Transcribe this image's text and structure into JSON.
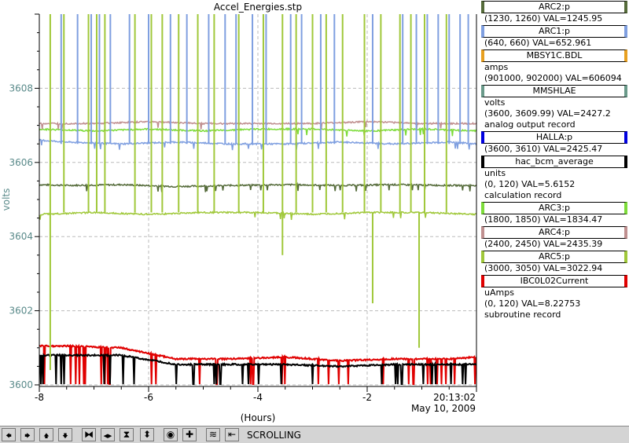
{
  "window_title": "Accel_Energies.stp",
  "chart_data": {
    "type": "line",
    "title": "Accel_Energies.stp",
    "xlabel": "(Hours)",
    "ylabel": "volts",
    "xlim": [
      -8,
      0
    ],
    "ylim": [
      3600,
      3610
    ],
    "x_ticks": [
      "-8",
      "-6",
      "-4",
      "-2"
    ],
    "y_ticks": [
      "3600",
      "3602",
      "3604",
      "3606",
      "3608"
    ],
    "time_label": "20:13:02",
    "date_label": "May 10, 2009",
    "grid": true,
    "legend_placement": "right",
    "series": [
      {
        "name": "ARC2:p",
        "color": "#556b3a",
        "range": "(1230, 1260)",
        "value": "VAL=1245.95",
        "baseline": 3605.38,
        "x": [
          -8,
          -7.5,
          -6.5,
          -5.5,
          -4.5,
          -3.5,
          -2.5,
          -1.5,
          -0.5,
          0
        ],
        "y": [
          3605.4,
          3605.38,
          3605.4,
          3605.35,
          3605.38,
          3605.4,
          3605.38,
          3605.4,
          3605.38,
          3605.38
        ]
      },
      {
        "name": "ARC1:p",
        "color": "#7f9fe0",
        "range": "(640, 660)",
        "value": "VAL=652.961",
        "baseline": 3606.5,
        "x": [
          -8,
          -7.5,
          -6.5,
          -5.5,
          -4.5,
          -3.5,
          -2.5,
          -1.5,
          -0.5,
          0
        ],
        "y": [
          3606.6,
          3606.55,
          3606.5,
          3606.55,
          3606.5,
          3606.5,
          3606.55,
          3606.5,
          3606.55,
          3606.5
        ]
      },
      {
        "name": "ARC3:p",
        "color": "#7ddc3a",
        "range": "(1800, 1850)",
        "value": "VAL=1834.47",
        "baseline": 3606.9,
        "x": [
          -8,
          -7,
          -6,
          -5,
          -4,
          -3,
          -2,
          -1,
          0
        ],
        "y": [
          3606.9,
          3606.85,
          3606.9,
          3606.85,
          3606.9,
          3606.9,
          3606.85,
          3606.9,
          3606.85
        ]
      },
      {
        "name": "ARC4:p",
        "color": "#c09090",
        "range": "(2400, 2450)",
        "value": "VAL=2435.39",
        "baseline": 3607.05,
        "x": [
          -8,
          -7,
          -6,
          -5,
          -4,
          -3,
          -2,
          -1,
          0
        ],
        "y": [
          3607.05,
          3607.05,
          3607.1,
          3607.05,
          3607.05,
          3607.05,
          3607.1,
          3607.05,
          3607.05
        ]
      },
      {
        "name": "ARC5:p",
        "color": "#a0c83a",
        "range": "(3000, 3050)",
        "value": "VAL=3022.94",
        "baseline": 3604.65,
        "x": [
          -8,
          -7,
          -6,
          -5,
          -4,
          -3,
          -2,
          -1,
          0
        ],
        "y": [
          3604.6,
          3604.65,
          3604.6,
          3604.65,
          3604.65,
          3604.6,
          3604.65,
          3604.65,
          3604.6
        ]
      },
      {
        "name": "IBC0L02Current",
        "color": "#e00000",
        "range": "(0, 120)",
        "value": "VAL=8.22753",
        "baseline": 3601.05,
        "x": [
          -8,
          -7.5,
          -6.5,
          -5.5,
          -4.5,
          -3.5,
          -2.5,
          -1.5,
          -0.5,
          0
        ],
        "y": [
          3601.05,
          3601.05,
          3601.0,
          3600.7,
          3600.7,
          3600.75,
          3600.65,
          3600.7,
          3600.7,
          3600.75
        ]
      },
      {
        "name": "hac_bcm_average",
        "color": "#000000",
        "range": "(0, 120)",
        "value": "VAL=5.6152",
        "baseline": 3600.8,
        "x": [
          -8,
          -7.5,
          -6.5,
          -5.5,
          -4.5,
          -3.5,
          -2.5,
          -1.5,
          -0.5,
          0
        ],
        "y": [
          3600.8,
          3600.8,
          3600.8,
          3600.55,
          3600.55,
          3600.55,
          3600.5,
          3600.55,
          3600.55,
          3600.55
        ]
      }
    ],
    "spikes": [
      {
        "series": "ARC1:p",
        "x": [
          -7.6,
          -7.3,
          -7.05,
          -6.9,
          -6.7,
          -6.35,
          -6.0,
          -5.6,
          -5.3,
          -4.9,
          -4.6,
          -4.4,
          -4.1,
          -3.85,
          -3.4,
          -3.2,
          -2.85,
          -2.6,
          -1.9,
          -1.35,
          -1.1,
          -0.9,
          -0.7,
          -0.5,
          -0.3,
          -0.15
        ]
      },
      {
        "series": "ARC5:p",
        "x": [
          -7.8,
          -7.55,
          -7.1,
          -6.95,
          -6.8,
          -6.25,
          -5.95,
          -5.75,
          -5.45,
          -5.1,
          -4.8,
          -4.35,
          -3.9,
          -3.55,
          -3.3,
          -3.0,
          -2.75,
          -2.45,
          -2.05,
          -1.75,
          -1.4,
          -1.2,
          -0.95,
          -0.55
        ]
      }
    ]
  },
  "legend": [
    {
      "name": "ARC2:p",
      "color": "#556b3a",
      "lines": [
        "(1230, 1260) VAL=1245.95"
      ]
    },
    {
      "name": "ARC1:p",
      "color": "#7f9fe0",
      "lines": [
        "(640, 660) VAL=652.961"
      ]
    },
    {
      "name": "MBSY1C.BDL",
      "color": "#e8a020",
      "lines": [
        "amps",
        "(901000, 902000) VAL=606094"
      ]
    },
    {
      "name": "MMSHLAE",
      "color": "#6a9a8a",
      "lines": [
        "volts",
        "(3600, 3609.99) VAL=2427.2",
        "analog output record"
      ]
    },
    {
      "name": "HALLA:p",
      "color": "#0000e0",
      "lines": [
        "(3600, 3610) VAL=2425.47"
      ]
    },
    {
      "name": "hac_bcm_average",
      "color": "#000000",
      "lines": [
        "units",
        "(0, 120) VAL=5.6152",
        "calculation record"
      ]
    },
    {
      "name": "ARC3:p",
      "color": "#7ddc3a",
      "lines": [
        "(1800, 1850) VAL=1834.47"
      ]
    },
    {
      "name": "ARC4:p",
      "color": "#c09090",
      "lines": [
        "(2400, 2450) VAL=2435.39"
      ]
    },
    {
      "name": "ARC5:p",
      "color": "#a0c83a",
      "lines": [
        "(3000, 3050) VAL=3022.94"
      ]
    },
    {
      "name": "IBC0L02Current",
      "color": "#e00000",
      "lines": [
        "uAmps",
        "(0, 120) VAL=8.22753",
        "subroutine record"
      ]
    }
  ],
  "toolbar": {
    "buttons": [
      {
        "name": "scroll-left-button",
        "icon": "arrow-left-icon",
        "glyph": "🡄"
      },
      {
        "name": "scroll-right-button",
        "icon": "arrow-right-icon",
        "glyph": "🡆"
      },
      {
        "name": "scroll-up-button",
        "icon": "arrow-up-icon",
        "glyph": "🡅"
      },
      {
        "name": "scroll-down-button",
        "icon": "arrow-down-icon",
        "glyph": "🡇"
      },
      {
        "name": "zoom-in-x-button",
        "icon": "zoom-in-x-icon",
        "glyph": "⧓"
      },
      {
        "name": "zoom-out-x-button",
        "icon": "zoom-out-x-icon",
        "glyph": "◀▶"
      },
      {
        "name": "zoom-in-y-button",
        "icon": "zoom-in-y-icon",
        "glyph": "⧗"
      },
      {
        "name": "zoom-out-y-button",
        "icon": "zoom-out-y-icon",
        "glyph": "⬍"
      },
      {
        "name": "reset-button",
        "icon": "reset-icon",
        "glyph": "◉"
      },
      {
        "name": "add-button",
        "icon": "plus-icon",
        "glyph": "✚"
      },
      {
        "name": "auto-scale-button",
        "icon": "auto-scale-icon",
        "glyph": "≋"
      },
      {
        "name": "back-to-now-button",
        "icon": "back-to-now-icon",
        "glyph": "⇤"
      }
    ],
    "status": "SCROLLING"
  }
}
